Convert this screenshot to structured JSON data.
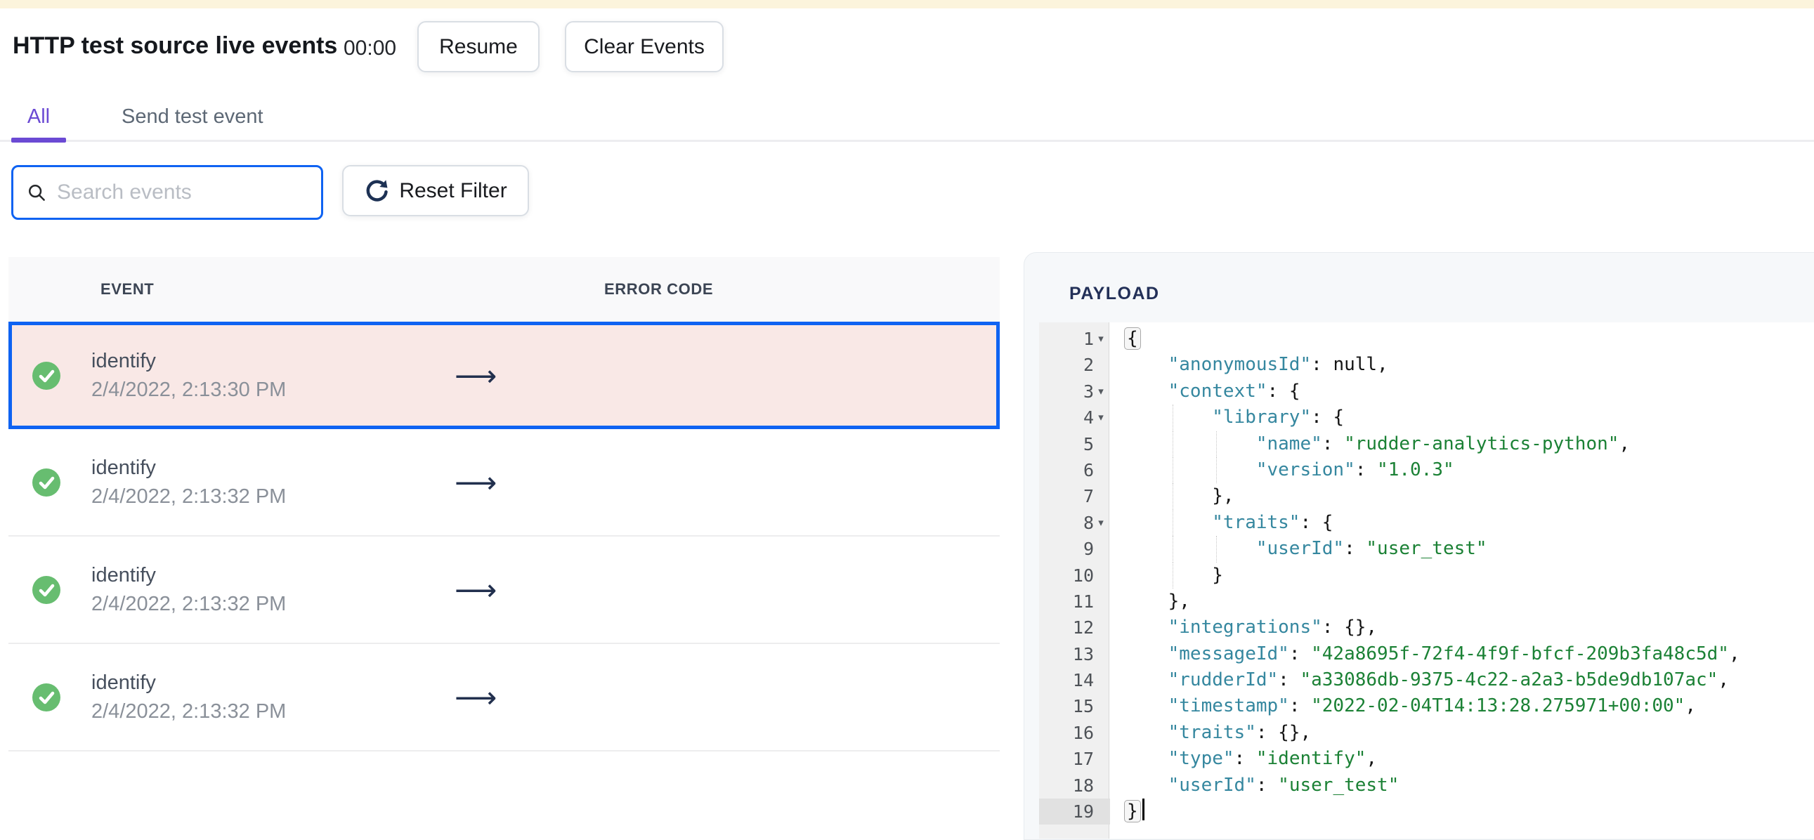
{
  "colors": {
    "cream": "#fcf4dc",
    "purple": "#6b4ad4",
    "blue": "#0f63f2",
    "green": "#67bd70",
    "pink": "#f9e8e6",
    "navy": "#233058",
    "key": "#35879f",
    "str": "#1b8135"
  },
  "header": {
    "title": "HTTP test source live events",
    "timer": "00:00",
    "resume_label": "Resume",
    "clear_label": "Clear Events"
  },
  "tabs": {
    "all": "All",
    "send": "Send test event"
  },
  "filter": {
    "search_placeholder": "Search events",
    "reset_label": "Reset Filter"
  },
  "table": {
    "columns": {
      "event": "EVENT",
      "error_code": "ERROR CODE"
    },
    "rows": [
      {
        "name": "identify",
        "timestamp": "2/4/2022, 2:13:30 PM",
        "status": "success",
        "selected": true
      },
      {
        "name": "identify",
        "timestamp": "2/4/2022, 2:13:32 PM",
        "status": "success",
        "selected": false
      },
      {
        "name": "identify",
        "timestamp": "2/4/2022, 2:13:32 PM",
        "status": "success",
        "selected": false
      },
      {
        "name": "identify",
        "timestamp": "2/4/2022, 2:13:32 PM",
        "status": "success",
        "selected": false
      }
    ]
  },
  "payload": {
    "title": "PAYLOAD",
    "lines": [
      {
        "no": 1,
        "fold": true,
        "active": false,
        "cursor": false,
        "tokens": [
          {
            "t": "{",
            "c": "b"
          }
        ]
      },
      {
        "no": 2,
        "fold": false,
        "active": false,
        "cursor": false,
        "tokens": [
          {
            "t": "    ",
            "c": "p"
          },
          {
            "t": "\"anonymousId\"",
            "c": "k"
          },
          {
            "t": ": ",
            "c": "p"
          },
          {
            "t": "null,",
            "c": "p"
          }
        ]
      },
      {
        "no": 3,
        "fold": true,
        "active": false,
        "cursor": false,
        "tokens": [
          {
            "t": "    ",
            "c": "p"
          },
          {
            "t": "\"context\"",
            "c": "k"
          },
          {
            "t": ": {",
            "c": "p"
          }
        ]
      },
      {
        "no": 4,
        "fold": true,
        "active": false,
        "cursor": false,
        "tokens": [
          {
            "t": "        ",
            "c": "p"
          },
          {
            "t": "\"library\"",
            "c": "k"
          },
          {
            "t": ": {",
            "c": "p"
          }
        ]
      },
      {
        "no": 5,
        "fold": false,
        "active": false,
        "cursor": false,
        "tokens": [
          {
            "t": "            ",
            "c": "p"
          },
          {
            "t": "\"name\"",
            "c": "k"
          },
          {
            "t": ": ",
            "c": "p"
          },
          {
            "t": "\"rudder-analytics-python\"",
            "c": "s"
          },
          {
            "t": ",",
            "c": "p"
          }
        ]
      },
      {
        "no": 6,
        "fold": false,
        "active": false,
        "cursor": false,
        "tokens": [
          {
            "t": "            ",
            "c": "p"
          },
          {
            "t": "\"version\"",
            "c": "k"
          },
          {
            "t": ": ",
            "c": "p"
          },
          {
            "t": "\"1.0.3\"",
            "c": "s"
          }
        ]
      },
      {
        "no": 7,
        "fold": false,
        "active": false,
        "cursor": false,
        "tokens": [
          {
            "t": "        },",
            "c": "p"
          }
        ]
      },
      {
        "no": 8,
        "fold": true,
        "active": false,
        "cursor": false,
        "tokens": [
          {
            "t": "        ",
            "c": "p"
          },
          {
            "t": "\"traits\"",
            "c": "k"
          },
          {
            "t": ": {",
            "c": "p"
          }
        ]
      },
      {
        "no": 9,
        "fold": false,
        "active": false,
        "cursor": false,
        "tokens": [
          {
            "t": "            ",
            "c": "p"
          },
          {
            "t": "\"userId\"",
            "c": "k"
          },
          {
            "t": ": ",
            "c": "p"
          },
          {
            "t": "\"user_test\"",
            "c": "s"
          }
        ]
      },
      {
        "no": 10,
        "fold": false,
        "active": false,
        "cursor": false,
        "tokens": [
          {
            "t": "        }",
            "c": "p"
          }
        ]
      },
      {
        "no": 11,
        "fold": false,
        "active": false,
        "cursor": false,
        "tokens": [
          {
            "t": "    },",
            "c": "p"
          }
        ]
      },
      {
        "no": 12,
        "fold": false,
        "active": false,
        "cursor": false,
        "tokens": [
          {
            "t": "    ",
            "c": "p"
          },
          {
            "t": "\"integrations\"",
            "c": "k"
          },
          {
            "t": ": {},",
            "c": "p"
          }
        ]
      },
      {
        "no": 13,
        "fold": false,
        "active": false,
        "cursor": false,
        "tokens": [
          {
            "t": "    ",
            "c": "p"
          },
          {
            "t": "\"messageId\"",
            "c": "k"
          },
          {
            "t": ": ",
            "c": "p"
          },
          {
            "t": "\"42a8695f-72f4-4f9f-bfcf-209b3fa48c5d\"",
            "c": "s"
          },
          {
            "t": ",",
            "c": "p"
          }
        ]
      },
      {
        "no": 14,
        "fold": false,
        "active": false,
        "cursor": false,
        "tokens": [
          {
            "t": "    ",
            "c": "p"
          },
          {
            "t": "\"rudderId\"",
            "c": "k"
          },
          {
            "t": ": ",
            "c": "p"
          },
          {
            "t": "\"a33086db-9375-4c22-a2a3-b5de9db107ac\"",
            "c": "s"
          },
          {
            "t": ",",
            "c": "p"
          }
        ]
      },
      {
        "no": 15,
        "fold": false,
        "active": false,
        "cursor": false,
        "tokens": [
          {
            "t": "    ",
            "c": "p"
          },
          {
            "t": "\"timestamp\"",
            "c": "k"
          },
          {
            "t": ": ",
            "c": "p"
          },
          {
            "t": "\"2022-02-04T14:13:28.275971+00:00\"",
            "c": "s"
          },
          {
            "t": ",",
            "c": "p"
          }
        ]
      },
      {
        "no": 16,
        "fold": false,
        "active": false,
        "cursor": false,
        "tokens": [
          {
            "t": "    ",
            "c": "p"
          },
          {
            "t": "\"traits\"",
            "c": "k"
          },
          {
            "t": ": {},",
            "c": "p"
          }
        ]
      },
      {
        "no": 17,
        "fold": false,
        "active": false,
        "cursor": false,
        "tokens": [
          {
            "t": "    ",
            "c": "p"
          },
          {
            "t": "\"type\"",
            "c": "k"
          },
          {
            "t": ": ",
            "c": "p"
          },
          {
            "t": "\"identify\"",
            "c": "s"
          },
          {
            "t": ",",
            "c": "p"
          }
        ]
      },
      {
        "no": 18,
        "fold": false,
        "active": false,
        "cursor": false,
        "tokens": [
          {
            "t": "    ",
            "c": "p"
          },
          {
            "t": "\"userId\"",
            "c": "k"
          },
          {
            "t": ": ",
            "c": "p"
          },
          {
            "t": "\"user_test\"",
            "c": "s"
          }
        ]
      },
      {
        "no": 19,
        "fold": false,
        "active": true,
        "cursor": true,
        "tokens": [
          {
            "t": "}",
            "c": "b"
          }
        ]
      }
    ]
  },
  "icons": {
    "arrow_glyph": "⟶",
    "fold_glyph": "▾"
  }
}
